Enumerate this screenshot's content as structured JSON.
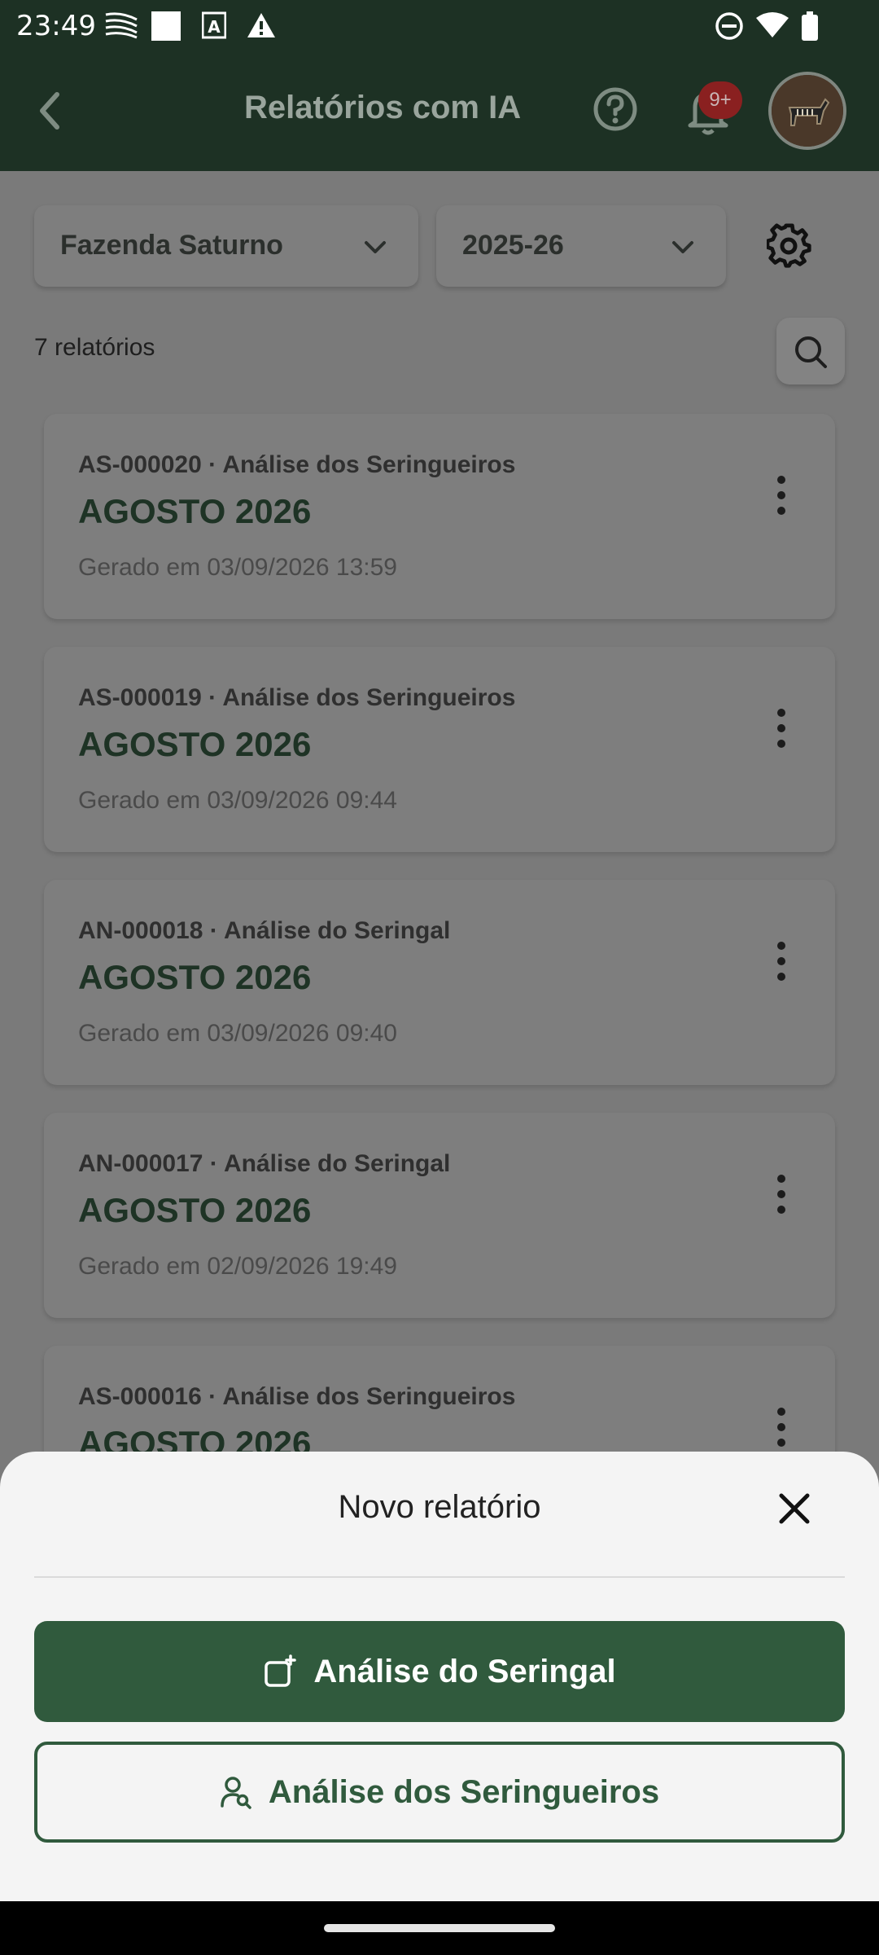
{
  "status_bar": {
    "time": "23:49",
    "icons": [
      "grid-pattern-icon",
      "square-icon",
      "text-a-icon",
      "warning-icon",
      "do-not-disturb-icon",
      "wifi-icon",
      "battery-icon"
    ]
  },
  "app_bar": {
    "title": "Relatórios com IA",
    "notification_badge": "9+",
    "icons": [
      "back-arrow-icon",
      "help-circle-icon",
      "bell-icon",
      "avatar"
    ]
  },
  "filters": {
    "farm": "Fazenda Saturno",
    "season": "2025-26"
  },
  "list": {
    "count_label": "7 relatórios",
    "items": [
      {
        "code": "AS-000020 · Análise dos Seringueiros",
        "period": "AGOSTO 2026",
        "generated": "Gerado em 03/09/2026 13:59"
      },
      {
        "code": "AS-000019 · Análise dos Seringueiros",
        "period": "AGOSTO 2026",
        "generated": "Gerado em 03/09/2026 09:44"
      },
      {
        "code": "AN-000018 · Análise do Seringal",
        "period": "AGOSTO 2026",
        "generated": "Gerado em 03/09/2026 09:40"
      },
      {
        "code": "AN-000017 · Análise do Seringal",
        "period": "AGOSTO 2026",
        "generated": "Gerado em 02/09/2026 19:49"
      },
      {
        "code": "AS-000016 · Análise dos Seringueiros",
        "period": "AGOSTO 2026",
        "generated": ""
      }
    ]
  },
  "sheet": {
    "title": "Novo relatório",
    "primary_button": "Análise do Seringal",
    "secondary_button": "Análise dos Seringueiros"
  },
  "colors": {
    "app_bar": "#1d3124",
    "primary": "#305a3d",
    "scrim_content": "#7a7a7a",
    "sheet_bg": "#f4f4f4"
  }
}
